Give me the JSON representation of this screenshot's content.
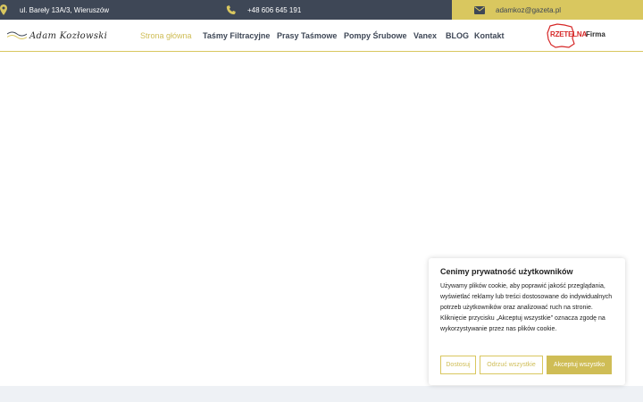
{
  "topbar": {
    "address": "ul. Bareły 13A/3, Wieruszów",
    "phone": "+48 606 645 191",
    "email": "adamkoz@gazeta.pl"
  },
  "header": {
    "logo_text": "Adam Kozłowski",
    "nav": [
      {
        "label": "Strona główna",
        "active": true
      },
      {
        "label": "Taśmy Filtracyjne",
        "active": false
      },
      {
        "label": "Prasy Taśmowe",
        "active": false
      },
      {
        "label": "Pompy Śrubowe",
        "active": false
      },
      {
        "label": "Vanex",
        "active": false
      },
      {
        "label": "BLOG",
        "active": false
      },
      {
        "label": "Kontakt",
        "active": false
      }
    ],
    "badge": {
      "red": "RZETELNA",
      "dark": "Firma"
    }
  },
  "cookie": {
    "title": "Cenimy prywatność użytkowników",
    "text": "Używamy plików cookie, aby poprawić jakość przeglądania, wyświetlać reklamy lub treści dostosowane do indywidualnych potrzeb użytkowników oraz analizować ruch na stronie. Kliknięcie przycisku „Akceptuj wszystkie” oznacza zgodę na wykorzystywanie przez nas plików cookie.",
    "customize_label": "Dostosuj",
    "reject_label": "Odrzuć wszystkie",
    "accept_label": "Akceptuj wszystko"
  },
  "colors": {
    "topbar_bg": "#3e4756",
    "accent": "#d9c75f",
    "text_dark": "#3e4756",
    "badge_red": "#d62828"
  },
  "icons": {
    "address": "map-pin-icon",
    "phone": "phone-icon",
    "email": "mail-icon"
  }
}
